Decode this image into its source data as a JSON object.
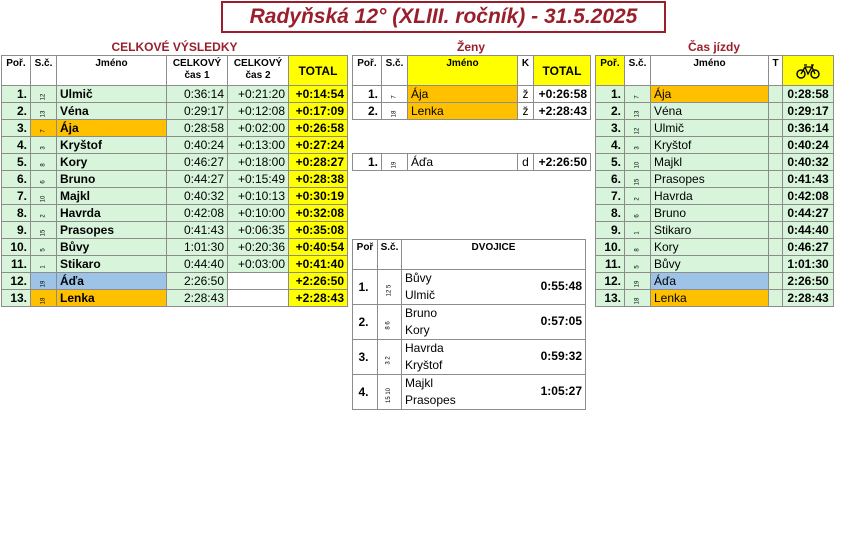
{
  "title": "Radyňská 12° (XLIII. ročník) - 31.5.2025",
  "overall": {
    "section_title": "CELKOVÉ VÝSLEDKY",
    "headers": {
      "rank": "Poř.",
      "sc": "S.č.",
      "name": "Jméno",
      "time1_a": "CELKOVÝ",
      "time1_b": "čas 1",
      "time2_a": "CELKOVÝ",
      "time2_b": "čas 2",
      "total": "TOTAL"
    },
    "rows": [
      {
        "rank": "1.",
        "sc": "12",
        "name": "Ulmič",
        "t1": "0:36:14",
        "t2": "+0:21:20",
        "total": "+0:14:54"
      },
      {
        "rank": "2.",
        "sc": "13",
        "name": "Véna",
        "t1": "0:29:17",
        "t2": "+0:12:08",
        "total": "+0:17:09"
      },
      {
        "rank": "3.",
        "sc": "7",
        "name": "Ája",
        "t1": "0:28:58",
        "t2": "+0:02:00",
        "total": "+0:26:58"
      },
      {
        "rank": "4.",
        "sc": "3",
        "name": "Kryštof",
        "t1": "0:40:24",
        "t2": "+0:13:00",
        "total": "+0:27:24"
      },
      {
        "rank": "5.",
        "sc": "8",
        "name": "Kory",
        "t1": "0:46:27",
        "t2": "+0:18:00",
        "total": "+0:28:27"
      },
      {
        "rank": "6.",
        "sc": "6",
        "name": "Bruno",
        "t1": "0:44:27",
        "t2": "+0:15:49",
        "total": "+0:28:38"
      },
      {
        "rank": "7.",
        "sc": "10",
        "name": "Majkl",
        "t1": "0:40:32",
        "t2": "+0:10:13",
        "total": "+0:30:19"
      },
      {
        "rank": "8.",
        "sc": "2",
        "name": "Havrda",
        "t1": "0:42:08",
        "t2": "+0:10:00",
        "total": "+0:32:08"
      },
      {
        "rank": "9.",
        "sc": "15",
        "name": "Prasopes",
        "t1": "0:41:43",
        "t2": "+0:06:35",
        "total": "+0:35:08"
      },
      {
        "rank": "10.",
        "sc": "5",
        "name": "Bůvy",
        "t1": "1:01:30",
        "t2": "+0:20:36",
        "total": "+0:40:54"
      },
      {
        "rank": "11.",
        "sc": "1",
        "name": "Stikaro",
        "t1": "0:44:40",
        "t2": "+0:03:00",
        "total": "+0:41:40"
      },
      {
        "rank": "12.",
        "sc": "19",
        "name": "Áďa",
        "t1": "2:26:50",
        "t2": "",
        "total": "+2:26:50"
      },
      {
        "rank": "13.",
        "sc": "18",
        "name": "Lenka",
        "t1": "2:28:43",
        "t2": "",
        "total": "+2:28:43"
      }
    ]
  },
  "women": {
    "section_title": "Ženy",
    "headers": {
      "rank": "Poř.",
      "sc": "S.č.",
      "name": "Jméno",
      "k": "K",
      "total": "TOTAL"
    },
    "rows": [
      {
        "rank": "1.",
        "sc": "7",
        "name": "Ája",
        "k": "ž",
        "total": "+0:26:58"
      },
      {
        "rank": "2.",
        "sc": "18",
        "name": "Lenka",
        "k": "ž",
        "total": "+2:28:43"
      }
    ],
    "extra_row": {
      "rank": "1.",
      "sc": "19",
      "name": "Áďa",
      "k": "d",
      "total": "+2:26:50"
    }
  },
  "pairs": {
    "headers": {
      "rank": "Poř",
      "sc": "S.č.",
      "title": "DVOJICE"
    },
    "rows": [
      {
        "rank": "1.",
        "sc": "12  5",
        "name1": "Bůvy",
        "name2": "Ulmič",
        "time": "0:55:48"
      },
      {
        "rank": "2.",
        "sc": "8  6",
        "name1": "Bruno",
        "name2": "Kory",
        "time": "0:57:05"
      },
      {
        "rank": "3.",
        "sc": "3  2",
        "name1": "Havrda",
        "name2": "Kryštof",
        "time": "0:59:32"
      },
      {
        "rank": "4.",
        "sc": "15  10",
        "name1": "Majkl",
        "name2": "Prasopes",
        "time": "1:05:27"
      }
    ]
  },
  "ride_time": {
    "section_title": "Čas jízdy",
    "headers": {
      "rank": "Poř.",
      "sc": "S.č.",
      "name": "Jméno",
      "t": "T",
      "icon": "bicycle-icon"
    },
    "rows": [
      {
        "rank": "1.",
        "sc": "7",
        "name": "Ája",
        "time": "0:28:58"
      },
      {
        "rank": "2.",
        "sc": "13",
        "name": "Véna",
        "time": "0:29:17"
      },
      {
        "rank": "3.",
        "sc": "12",
        "name": "Ulmič",
        "time": "0:36:14"
      },
      {
        "rank": "4.",
        "sc": "3",
        "name": "Kryštof",
        "time": "0:40:24"
      },
      {
        "rank": "5.",
        "sc": "10",
        "name": "Majkl",
        "time": "0:40:32"
      },
      {
        "rank": "6.",
        "sc": "15",
        "name": "Prasopes",
        "time": "0:41:43"
      },
      {
        "rank": "7.",
        "sc": "2",
        "name": "Havrda",
        "time": "0:42:08"
      },
      {
        "rank": "8.",
        "sc": "6",
        "name": "Bruno",
        "time": "0:44:27"
      },
      {
        "rank": "9.",
        "sc": "1",
        "name": "Stikaro",
        "time": "0:44:40"
      },
      {
        "rank": "10.",
        "sc": "8",
        "name": "Kory",
        "time": "0:46:27"
      },
      {
        "rank": "11.",
        "sc": "5",
        "name": "Bůvy",
        "time": "1:01:30"
      },
      {
        "rank": "12.",
        "sc": "19",
        "name": "Áďa",
        "time": "2:26:50"
      },
      {
        "rank": "13.",
        "sc": "18",
        "name": "Lenka",
        "time": "2:28:43"
      }
    ]
  },
  "colors": {
    "title": "#9a1f2c",
    "row_green": "#d8f5dc",
    "row_orange": "#ffc000",
    "row_blue": "#9dc3e6",
    "total_yellow": "#ffff00"
  }
}
